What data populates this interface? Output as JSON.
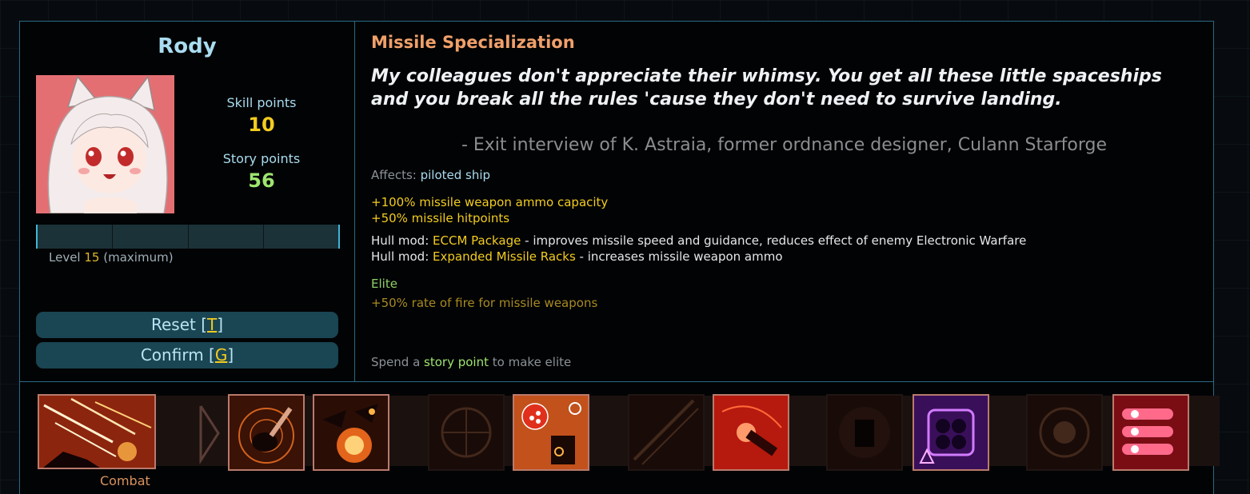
{
  "character": {
    "name": "Rody",
    "skill_points_label": "Skill points",
    "skill_points": "10",
    "story_points_label": "Story points",
    "story_points": "56",
    "level_prefix": "Level",
    "level": "15",
    "level_suffix": "(maximum)",
    "xp_progress": 1.0
  },
  "buttons": {
    "reset_label": "Reset [",
    "reset_key": "T",
    "confirm_label": "Confirm [",
    "confirm_key": "G",
    "close_bracket": "]"
  },
  "skill": {
    "title": "Missile Specialization",
    "quote": "My colleagues don't appreciate their whimsy. You get all these little spaceships and you break all the rules 'cause they don't need to survive landing.",
    "attribution": "- Exit interview of K. Astraia, former ordnance designer, Culann Starforge",
    "affects_label": "Affects:",
    "affects_value": "piloted ship",
    "effects": [
      "+100% missile weapon ammo capacity",
      "+50% missile hitpoints"
    ],
    "hull_mods": [
      {
        "prefix": "Hull mod:",
        "name": "ECCM Package",
        "desc": "- improves missile speed and guidance, reduces effect of enemy Electronic Warfare"
      },
      {
        "prefix": "Hull mod:",
        "name": "Expanded Missile Racks",
        "desc": "- increases missile weapon ammo"
      }
    ],
    "elite_label": "Elite",
    "elite_effect": "+50% rate of fire for missile weapons",
    "story_hint_pre": "Spend a",
    "story_hint_link": "story point",
    "story_hint_post": "to make elite"
  },
  "aptitude": {
    "name": "Combat",
    "skills": [
      {
        "icon": "combat-aptitude-icon",
        "state": "selected"
      },
      {
        "icon": "helmsmanship-icon",
        "state": "learned"
      },
      {
        "icon": "combat-endurance-icon",
        "state": "learned"
      },
      {
        "icon": "impact-mitigation-icon",
        "state": "locked"
      },
      {
        "icon": "damage-control-icon",
        "state": "learned"
      },
      {
        "icon": "field-modulation-icon",
        "state": "locked"
      },
      {
        "icon": "point-defense-icon",
        "state": "learned"
      },
      {
        "icon": "target-analysis-icon",
        "state": "locked"
      },
      {
        "icon": "ballistic-mastery-icon",
        "state": "learned"
      },
      {
        "icon": "systems-expertise-icon",
        "state": "locked"
      },
      {
        "icon": "missile-specialization-icon",
        "state": "learned"
      }
    ]
  },
  "colors": {
    "accent": "#a9dcf0",
    "gold": "#f3cc1f",
    "green": "#9ee56f",
    "title": "#f0a06a",
    "panel_border": "#2a6a86"
  }
}
